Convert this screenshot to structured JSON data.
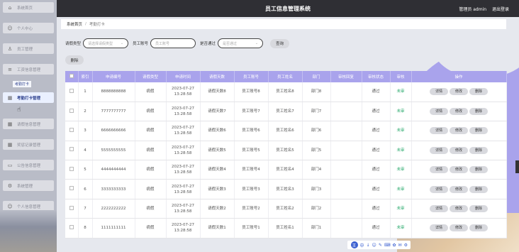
{
  "header": {
    "title": "员工信息管理系统",
    "user_label": "管理员 admin",
    "logout_label": "退出登录"
  },
  "sidebar": {
    "items": [
      {
        "label": "系统首页",
        "icon": "home-icon"
      },
      {
        "label": "个人中心",
        "icon": "user-icon"
      },
      {
        "label": "员工管理",
        "icon": "users-icon"
      },
      {
        "label": "工资信息管理",
        "icon": "list-icon"
      },
      {
        "label": "考勤打卡管理",
        "icon": "grid-icon"
      },
      {
        "label": "请假信息管理",
        "icon": "grid-icon"
      },
      {
        "label": "奖惩记录管理",
        "icon": "grid-icon"
      },
      {
        "label": "公告信息管理",
        "icon": "folder-icon"
      },
      {
        "label": "系统管理",
        "icon": "gear-icon"
      },
      {
        "label": "个人信息管理",
        "icon": "user-icon"
      }
    ],
    "sub_item": "考勤打卡"
  },
  "breadcrumb": {
    "root": "系统首页",
    "current": "考勤打卡"
  },
  "search": {
    "field1_label": "请假类型",
    "field1_placeholder": "请选择请假类型",
    "field2_label": "员工账号",
    "field2_placeholder": "员工账号",
    "field3_label": "是否通过",
    "field3_placeholder": "是否通过",
    "search_button": "查询",
    "delete_button": "删除"
  },
  "table": {
    "columns": [
      "",
      "索引",
      "申请编号",
      "请假类型",
      "申请时间",
      "请假天数",
      "员工账号",
      "员工姓名",
      "部门",
      "审核回复",
      "审核状态",
      "审核",
      "操作"
    ],
    "rows": [
      {
        "index": "1",
        "code": "8888888888",
        "type": "病假",
        "time": "2023-07-27 13:28:58",
        "days": "请假天数8",
        "account": "员工账号8",
        "name": "员工姓名8",
        "dept": "部门8",
        "reply": "",
        "audit": "通过",
        "status": "未审"
      },
      {
        "index": "2",
        "code": "7777777777",
        "type": "病假",
        "time": "2023-07-27 13:28:58",
        "days": "请假天数7",
        "account": "员工账号7",
        "name": "员工姓名7",
        "dept": "部门7",
        "reply": "",
        "audit": "通过",
        "status": "未审"
      },
      {
        "index": "3",
        "code": "6666666666",
        "type": "病假",
        "time": "2023-07-27 13:28:58",
        "days": "请假天数6",
        "account": "员工账号6",
        "name": "员工姓名6",
        "dept": "部门6",
        "reply": "",
        "audit": "通过",
        "status": "未审"
      },
      {
        "index": "4",
        "code": "5555555555",
        "type": "病假",
        "time": "2023-07-27 13:28:58",
        "days": "请假天数5",
        "account": "员工账号5",
        "name": "员工姓名5",
        "dept": "部门5",
        "reply": "",
        "audit": "通过",
        "status": "未审"
      },
      {
        "index": "5",
        "code": "4444444444",
        "type": "病假",
        "time": "2023-07-27 13:28:58",
        "days": "请假天数4",
        "account": "员工账号4",
        "name": "员工姓名4",
        "dept": "部门4",
        "reply": "",
        "audit": "通过",
        "status": "未审"
      },
      {
        "index": "6",
        "code": "3333333333",
        "type": "病假",
        "time": "2023-07-27 13:28:58",
        "days": "请假天数3",
        "account": "员工账号3",
        "name": "员工姓名3",
        "dept": "部门3",
        "reply": "",
        "audit": "通过",
        "status": "未审"
      },
      {
        "index": "7",
        "code": "2222222222",
        "type": "病假",
        "time": "2023-07-27 13:28:58",
        "days": "请假天数2",
        "account": "员工账号2",
        "name": "员工姓名2",
        "dept": "部门2",
        "reply": "",
        "audit": "通过",
        "status": "未审"
      },
      {
        "index": "8",
        "code": "1111111111",
        "type": "病假",
        "time": "2023-07-27 13:28:58",
        "days": "请假天数1",
        "account": "员工账号1",
        "name": "员工姓名1",
        "dept": "部门1",
        "reply": "",
        "audit": "通过",
        "status": "未审"
      }
    ],
    "actions": [
      "详情",
      "修改",
      "删除"
    ]
  },
  "toolbar": {
    "items": [
      "中",
      "↓",
      "☺",
      "✎",
      "⌨",
      "✿",
      "✉",
      "⚙"
    ]
  }
}
